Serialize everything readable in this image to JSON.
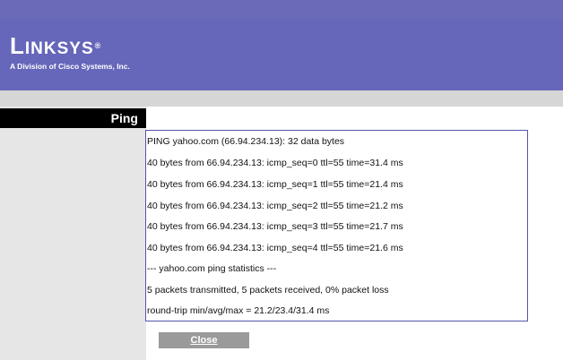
{
  "header": {
    "logo_text_big": "L",
    "logo_text_small": "INKSYS",
    "logo_reg": "®",
    "tagline": "A Division of Cisco Systems, Inc."
  },
  "sidebar": {
    "section_label": "Ping"
  },
  "results": {
    "lines": [
      "PING yahoo.com (66.94.234.13): 32 data bytes",
      "40 bytes from 66.94.234.13: icmp_seq=0 ttl=55 time=31.4 ms",
      "40 bytes from 66.94.234.13: icmp_seq=1 ttl=55 time=21.4 ms",
      "40 bytes from 66.94.234.13: icmp_seq=2 ttl=55 time=21.2 ms",
      "40 bytes from 66.94.234.13: icmp_seq=3 ttl=55 time=21.7 ms",
      "40 bytes from 66.94.234.13: icmp_seq=4 ttl=55 time=21.6 ms",
      "--- yahoo.com ping statistics ---",
      "5 packets transmitted, 5 packets received, 0% packet loss",
      "round-trip min/avg/max = 21.2/23.4/31.4 ms"
    ]
  },
  "actions": {
    "close_label": "Close"
  },
  "colors": {
    "header": "#6666bb",
    "section_label_bg": "#000000",
    "left_panel": "#e6e6e6",
    "results_border": "#5555aa",
    "button": "#9a9a9a"
  }
}
